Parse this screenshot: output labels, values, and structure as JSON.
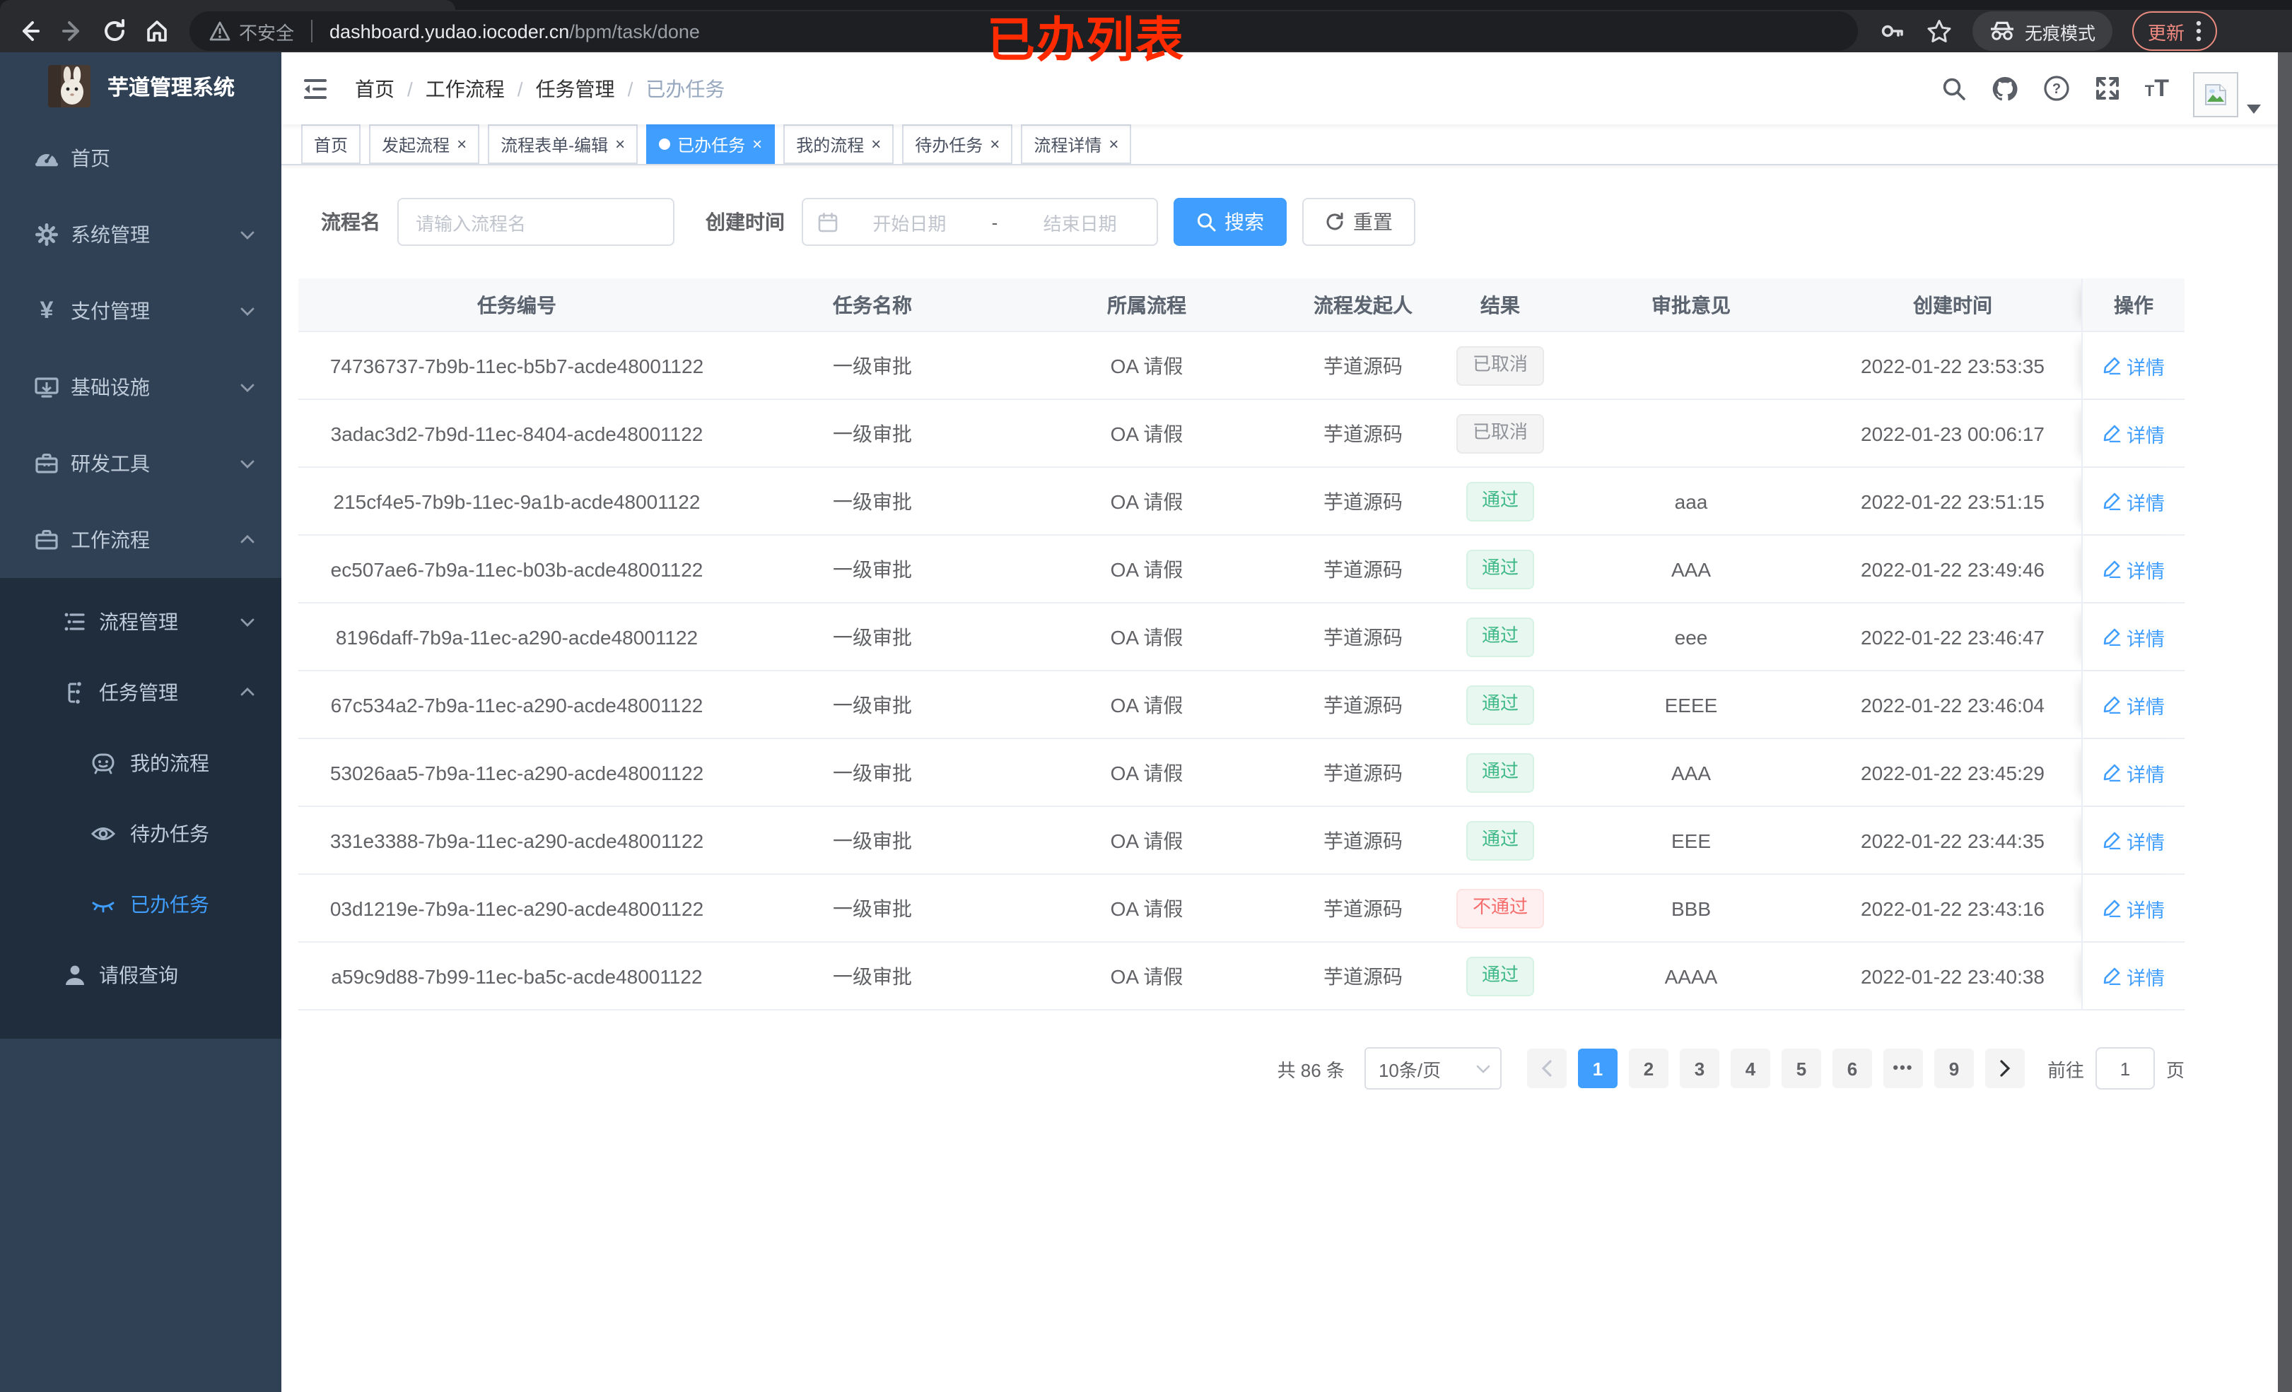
{
  "browser": {
    "security_label": "不安全",
    "url_host": "dashboard.yudao.iocoder.cn",
    "url_path": "/bpm/task/done",
    "incognito_label": "无痕模式",
    "update_label": "更新",
    "annotation": "已办列表"
  },
  "sidebar": {
    "app_title": "芋道管理系统",
    "items": [
      {
        "label": "首页"
      },
      {
        "label": "系统管理"
      },
      {
        "label": "支付管理"
      },
      {
        "label": "基础设施"
      },
      {
        "label": "研发工具"
      },
      {
        "label": "工作流程"
      },
      {
        "label": "流程管理"
      },
      {
        "label": "任务管理"
      },
      {
        "label": "我的流程"
      },
      {
        "label": "待办任务"
      },
      {
        "label": "已办任务"
      },
      {
        "label": "请假查询"
      }
    ]
  },
  "header": {
    "breadcrumb": [
      "首页",
      "工作流程",
      "任务管理",
      "已办任务"
    ]
  },
  "tabs": [
    {
      "label": "首页"
    },
    {
      "label": "发起流程"
    },
    {
      "label": "流程表单-编辑"
    },
    {
      "label": "已办任务"
    },
    {
      "label": "我的流程"
    },
    {
      "label": "待办任务"
    },
    {
      "label": "流程详情"
    }
  ],
  "filters": {
    "process_name_label": "流程名",
    "process_name_placeholder": "请输入流程名",
    "create_time_label": "创建时间",
    "start_placeholder": "开始日期",
    "range_separator": "-",
    "end_placeholder": "结束日期",
    "search_label": "搜索",
    "reset_label": "重置"
  },
  "table": {
    "columns": [
      "任务编号",
      "任务名称",
      "所属流程",
      "流程发起人",
      "结果",
      "审批意见",
      "创建时间",
      "操作"
    ],
    "rows": [
      {
        "id": "74736737-7b9b-11ec-b5b7-acde48001122",
        "name": "一级审批",
        "process": "OA 请假",
        "starter": "芋道源码",
        "result": "已取消",
        "result_type": "info",
        "comment": "",
        "created": "2022-01-22 23:53:35",
        "action": "详情"
      },
      {
        "id": "3adac3d2-7b9d-11ec-8404-acde48001122",
        "name": "一级审批",
        "process": "OA 请假",
        "starter": "芋道源码",
        "result": "已取消",
        "result_type": "info",
        "comment": "",
        "created": "2022-01-23 00:06:17",
        "action": "详情"
      },
      {
        "id": "215cf4e5-7b9b-11ec-9a1b-acde48001122",
        "name": "一级审批",
        "process": "OA 请假",
        "starter": "芋道源码",
        "result": "通过",
        "result_type": "success",
        "comment": "aaa",
        "created": "2022-01-22 23:51:15",
        "action": "详情"
      },
      {
        "id": "ec507ae6-7b9a-11ec-b03b-acde48001122",
        "name": "一级审批",
        "process": "OA 请假",
        "starter": "芋道源码",
        "result": "通过",
        "result_type": "success",
        "comment": "AAA",
        "created": "2022-01-22 23:49:46",
        "action": "详情"
      },
      {
        "id": "8196daff-7b9a-11ec-a290-acde48001122",
        "name": "一级审批",
        "process": "OA 请假",
        "starter": "芋道源码",
        "result": "通过",
        "result_type": "success",
        "comment": "eee",
        "created": "2022-01-22 23:46:47",
        "action": "详情"
      },
      {
        "id": "67c534a2-7b9a-11ec-a290-acde48001122",
        "name": "一级审批",
        "process": "OA 请假",
        "starter": "芋道源码",
        "result": "通过",
        "result_type": "success",
        "comment": "EEEE",
        "created": "2022-01-22 23:46:04",
        "action": "详情"
      },
      {
        "id": "53026aa5-7b9a-11ec-a290-acde48001122",
        "name": "一级审批",
        "process": "OA 请假",
        "starter": "芋道源码",
        "result": "通过",
        "result_type": "success",
        "comment": "AAA",
        "created": "2022-01-22 23:45:29",
        "action": "详情"
      },
      {
        "id": "331e3388-7b9a-11ec-a290-acde48001122",
        "name": "一级审批",
        "process": "OA 请假",
        "starter": "芋道源码",
        "result": "通过",
        "result_type": "success",
        "comment": "EEE",
        "created": "2022-01-22 23:44:35",
        "action": "详情"
      },
      {
        "id": "03d1219e-7b9a-11ec-a290-acde48001122",
        "name": "一级审批",
        "process": "OA 请假",
        "starter": "芋道源码",
        "result": "不通过",
        "result_type": "danger",
        "comment": "BBB",
        "created": "2022-01-22 23:43:16",
        "action": "详情"
      },
      {
        "id": "a59c9d88-7b99-11ec-ba5c-acde48001122",
        "name": "一级审批",
        "process": "OA 请假",
        "starter": "芋道源码",
        "result": "通过",
        "result_type": "success",
        "comment": "AAAA",
        "created": "2022-01-22 23:40:38",
        "action": "详情"
      }
    ]
  },
  "pagination": {
    "total_label": "共 86 条",
    "page_size": "10条/页",
    "pages": [
      "1",
      "2",
      "3",
      "4",
      "5",
      "6",
      "•••",
      "9"
    ],
    "active_page": "1",
    "goto_label": "前往",
    "goto_value": "1",
    "page_unit": "页"
  },
  "colors": {
    "accent": "#409eff",
    "sidebar_bg": "#304156",
    "submenu_bg": "#1f2d3d",
    "success": "#3eb886",
    "danger": "#f56c6c",
    "info": "#909399",
    "annotation_red": "#ff2b00"
  }
}
